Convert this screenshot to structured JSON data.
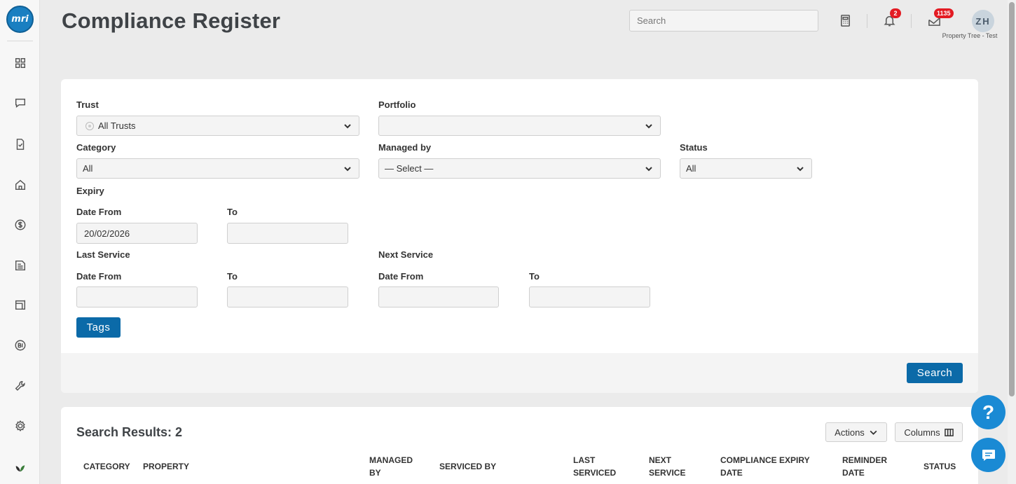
{
  "app": {
    "logo_text": "mri",
    "title": "Compliance Register"
  },
  "header": {
    "search_placeholder": "Search",
    "notifications_count": "2",
    "messages_count": "1135",
    "avatar_initials": "ZH",
    "account_name": "Property Tree - Test"
  },
  "sidebar": {
    "items": [
      {
        "icon": "dashboard-icon"
      },
      {
        "icon": "chat-icon"
      },
      {
        "icon": "task-icon"
      },
      {
        "icon": "home-icon"
      },
      {
        "icon": "dollar-icon"
      },
      {
        "icon": "document-icon"
      },
      {
        "icon": "inbox-icon"
      },
      {
        "icon": "bi-icon"
      },
      {
        "icon": "wrench-icon"
      },
      {
        "icon": "settings-icon"
      },
      {
        "icon": "leaf-icon"
      }
    ]
  },
  "filters": {
    "trust": {
      "label": "Trust",
      "value": "All Trusts"
    },
    "portfolio": {
      "label": "Portfolio",
      "value": ""
    },
    "category": {
      "label": "Category",
      "value": "All"
    },
    "managed_by": {
      "label": "Managed by",
      "value": "— Select —"
    },
    "status": {
      "label": "Status",
      "value": "All"
    },
    "expiry": {
      "label": "Expiry",
      "date_from_label": "Date From",
      "date_from_value": "20/02/2026",
      "to_label": "To",
      "to_value": ""
    },
    "last_service": {
      "label": "Last Service",
      "date_from_label": "Date From",
      "to_label": "To"
    },
    "next_service": {
      "label": "Next Service",
      "date_from_label": "Date From",
      "to_label": "To"
    },
    "tags_button": "Tags",
    "search_button": "Search"
  },
  "results": {
    "title": "Search Results: 2",
    "actions_button": "Actions",
    "columns_button": "Columns",
    "headers": [
      "Category",
      "Property",
      "Managed by",
      "Serviced by",
      "Last Serviced",
      "Next Service",
      "Compliance Expiry Date",
      "Reminder Date",
      "Status"
    ]
  },
  "floating": {
    "help_label": "?"
  },
  "colors": {
    "primary": "#0b6aa8",
    "fab": "#1a8ad4",
    "badge": "#e31b23"
  }
}
